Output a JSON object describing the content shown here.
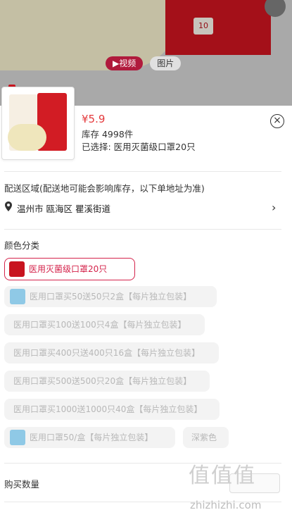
{
  "gallery": {
    "tabs": [
      {
        "label": "视频",
        "active": true
      },
      {
        "label": "图片",
        "active": false
      }
    ],
    "pack_badge": "10"
  },
  "product": {
    "price": "¥5.9",
    "stock": "库存 4998件",
    "selected": "已选择: 医用灭菌级口罩20只"
  },
  "shipping": {
    "title": "配送区域(配送地可能会影响库存，以下单地址为准)",
    "address": "温州市 瓯海区 瞿溪街道"
  },
  "variants": {
    "title": "颜色分类",
    "options": [
      {
        "label": "医用灭菌级口罩20只",
        "state": "selected",
        "icon": "red-pack"
      },
      {
        "label": "医用口罩买50送50只2盒【每片独立包装】",
        "state": "disabled",
        "icon": "blue-pack"
      },
      {
        "label": "医用口罩买100送100只4盒【每片独立包装】",
        "state": "disabled",
        "icon": ""
      },
      {
        "label": "医用口罩买400只送400只16盒【每片独立包装】",
        "state": "disabled",
        "icon": ""
      },
      {
        "label": "医用口罩买500送500只20盒【每片独立包装】",
        "state": "disabled",
        "icon": ""
      },
      {
        "label": "医用口罩买1000送1000只40盒【每片独立包装】",
        "state": "disabled",
        "icon": ""
      },
      {
        "label": "医用口罩50/盒【每片独立包装】",
        "state": "disabled",
        "icon": "blue-pack"
      },
      {
        "label": "深紫色",
        "state": "disabled",
        "icon": ""
      }
    ]
  },
  "quantity": {
    "title": "购买数量"
  },
  "watermark": {
    "logo": "值值值",
    "domain": "zhizhizhi.com"
  },
  "colors": {
    "accent": "#d4234b",
    "price": "#e4393c"
  }
}
